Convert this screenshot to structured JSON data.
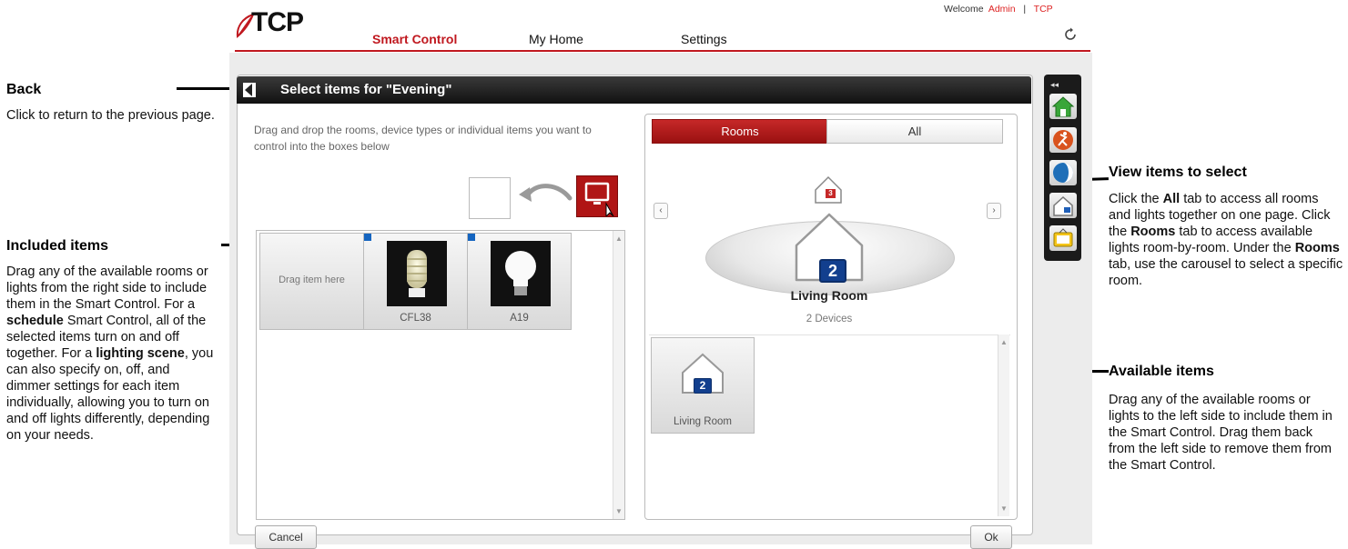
{
  "annotations": {
    "back": {
      "title": "Back",
      "text": "Click to return to the previous page."
    },
    "included": {
      "title": "Included items",
      "text_parts": [
        "Drag any of the available rooms or lights from the right side to include them in the Smart Control. For a ",
        "schedule",
        " Smart Control, all of the selected items turn on and off together. For a ",
        "lighting scene",
        ", you can also specify on, off, and dimmer settings for each item individually, allowing you to turn on and off lights differently, depending on your needs."
      ]
    },
    "view": {
      "title": "View items to select",
      "text_parts": [
        "Click the ",
        "All",
        " tab to access all rooms and lights together on one page. Click the ",
        "Rooms",
        " tab to access available lights room-by-room. Under the ",
        "Rooms",
        " tab, use the carousel to select a specific room."
      ]
    },
    "available": {
      "title": "Available items",
      "text": "Drag any of the available rooms or lights to the left side to include them in the Smart Control. Drag them back from the left side to remove them from the Smart Control."
    }
  },
  "header": {
    "logo": "TCP",
    "welcome_prefix": "Welcome",
    "user": "Admin",
    "separator": "|",
    "brand_link": "TCP",
    "nav": [
      "Smart Control",
      "My Home",
      "Settings"
    ],
    "active_nav": "Smart Control",
    "refresh_icon": "refresh-icon"
  },
  "dialog": {
    "title": "Select items for \"Evening\"",
    "instructions": "Drag and drop the rooms, device types or individual items you want to control into the boxes below",
    "drag_demo_label": "LCD Television",
    "included_items": [
      {
        "label": "Drag item here"
      },
      {
        "label": "CFL38"
      },
      {
        "label": "A19"
      }
    ],
    "cancel": "Cancel",
    "ok": "Ok"
  },
  "right_panel": {
    "tabs": [
      "Rooms",
      "All"
    ],
    "active_tab": "Rooms",
    "carousel": {
      "prev": "‹",
      "next": "›",
      "room_badge": "2",
      "small_badge": "3",
      "room_name": "Living Room",
      "device_count": "2 Devices"
    },
    "available_items": [
      {
        "label": "Living Room",
        "badge": "2"
      }
    ]
  },
  "toolbar": {
    "collapse": "◂◂",
    "buttons": [
      "home-icon",
      "runner-icon",
      "globe-icon",
      "room-icon",
      "tv-icon"
    ]
  },
  "colors": {
    "brand_red": "#c0181f",
    "accent_blue": "#1565c0"
  }
}
